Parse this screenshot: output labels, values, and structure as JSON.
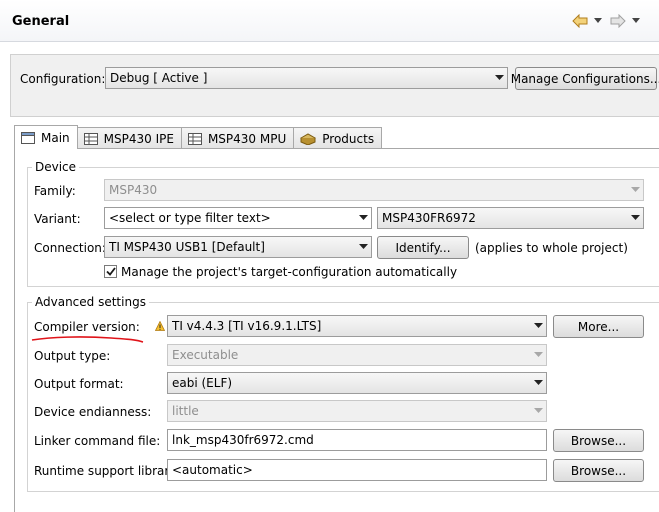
{
  "header": {
    "title": "General",
    "nav_back": "back-arrow-icon",
    "nav_forward": "forward-arrow-icon",
    "nav_menu": "chevron-down-icon"
  },
  "configuration": {
    "label": "Configuration:",
    "value": "Debug  [ Active ]",
    "manage_button": "Manage Configurations..."
  },
  "tabs": [
    {
      "label": "Main",
      "icon": "main-tab-icon",
      "active": true
    },
    {
      "label": "MSP430 IPE",
      "icon": "table-icon"
    },
    {
      "label": "MSP430 MPU",
      "icon": "table-icon"
    },
    {
      "label": "Products",
      "icon": "products-icon"
    }
  ],
  "device": {
    "title": "Device",
    "family_label": "Family:",
    "family_value": "MSP430",
    "variant_label": "Variant:",
    "variant_filter": "<select or type filter text>",
    "variant_value": "MSP430FR6972",
    "connection_label": "Connection:",
    "connection_value": "TI MSP430 USB1 [Default]",
    "identify_button": "Identify...",
    "identify_note": "(applies to whole project)",
    "manage_checkbox_label": "Manage the project's target-configuration automatically",
    "manage_checkbox_checked": true
  },
  "advanced": {
    "title": "Advanced settings",
    "compiler_label": "Compiler version:",
    "compiler_value": "TI v4.4.3  [TI v16.9.1.LTS]",
    "compiler_warning_icon": "warning-icon",
    "more_button": "More...",
    "output_type_label": "Output type:",
    "output_type_value": "Executable",
    "output_format_label": "Output format:",
    "output_format_value": "eabi (ELF)",
    "endianness_label": "Device endianness:",
    "endianness_value": "little",
    "linker_label": "Linker command file:",
    "linker_value": "lnk_msp430fr6972.cmd",
    "linker_browse": "Browse...",
    "runtime_label": "Runtime support library:",
    "runtime_value": "<automatic>",
    "runtime_browse": "Browse..."
  },
  "colors": {
    "annotation_underline": "#e0141a",
    "nav_arrow": "#e8b64c",
    "warning": "#e8a020"
  }
}
